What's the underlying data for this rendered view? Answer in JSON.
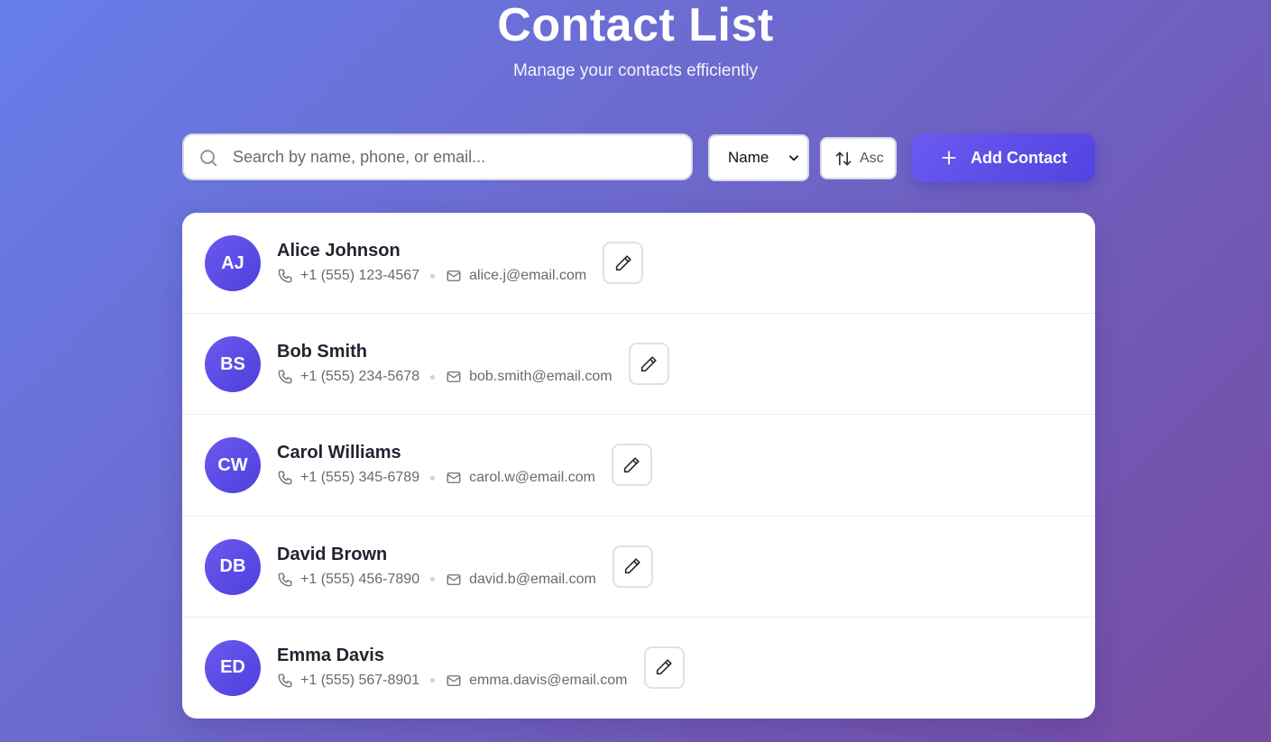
{
  "header": {
    "title": "Contact List",
    "subtitle": "Manage your contacts efficiently"
  },
  "toolbar": {
    "search_placeholder": "Search by name, phone, or email...",
    "search_value": "",
    "sort_selected": "Name",
    "order_label": "Asc",
    "add_label": "Add Contact"
  },
  "contacts": [
    {
      "initials": "AJ",
      "name": "Alice Johnson",
      "phone": "+1 (555) 123-4567",
      "email": "alice.j@email.com"
    },
    {
      "initials": "BS",
      "name": "Bob Smith",
      "phone": "+1 (555) 234-5678",
      "email": "bob.smith@email.com"
    },
    {
      "initials": "CW",
      "name": "Carol Williams",
      "phone": "+1 (555) 345-6789",
      "email": "carol.w@email.com"
    },
    {
      "initials": "DB",
      "name": "David Brown",
      "phone": "+1 (555) 456-7890",
      "email": "david.b@email.com"
    },
    {
      "initials": "ED",
      "name": "Emma Davis",
      "phone": "+1 (555) 567-8901",
      "email": "emma.davis@email.com"
    }
  ],
  "colors": {
    "background_start": "#667eea",
    "background_end": "#764ba2",
    "accent": "#5a4ae6"
  },
  "icons": [
    "search-icon",
    "chevron-down-icon",
    "sort-arrows-icon",
    "plus-icon",
    "phone-icon",
    "mail-icon",
    "pencil-icon"
  ]
}
